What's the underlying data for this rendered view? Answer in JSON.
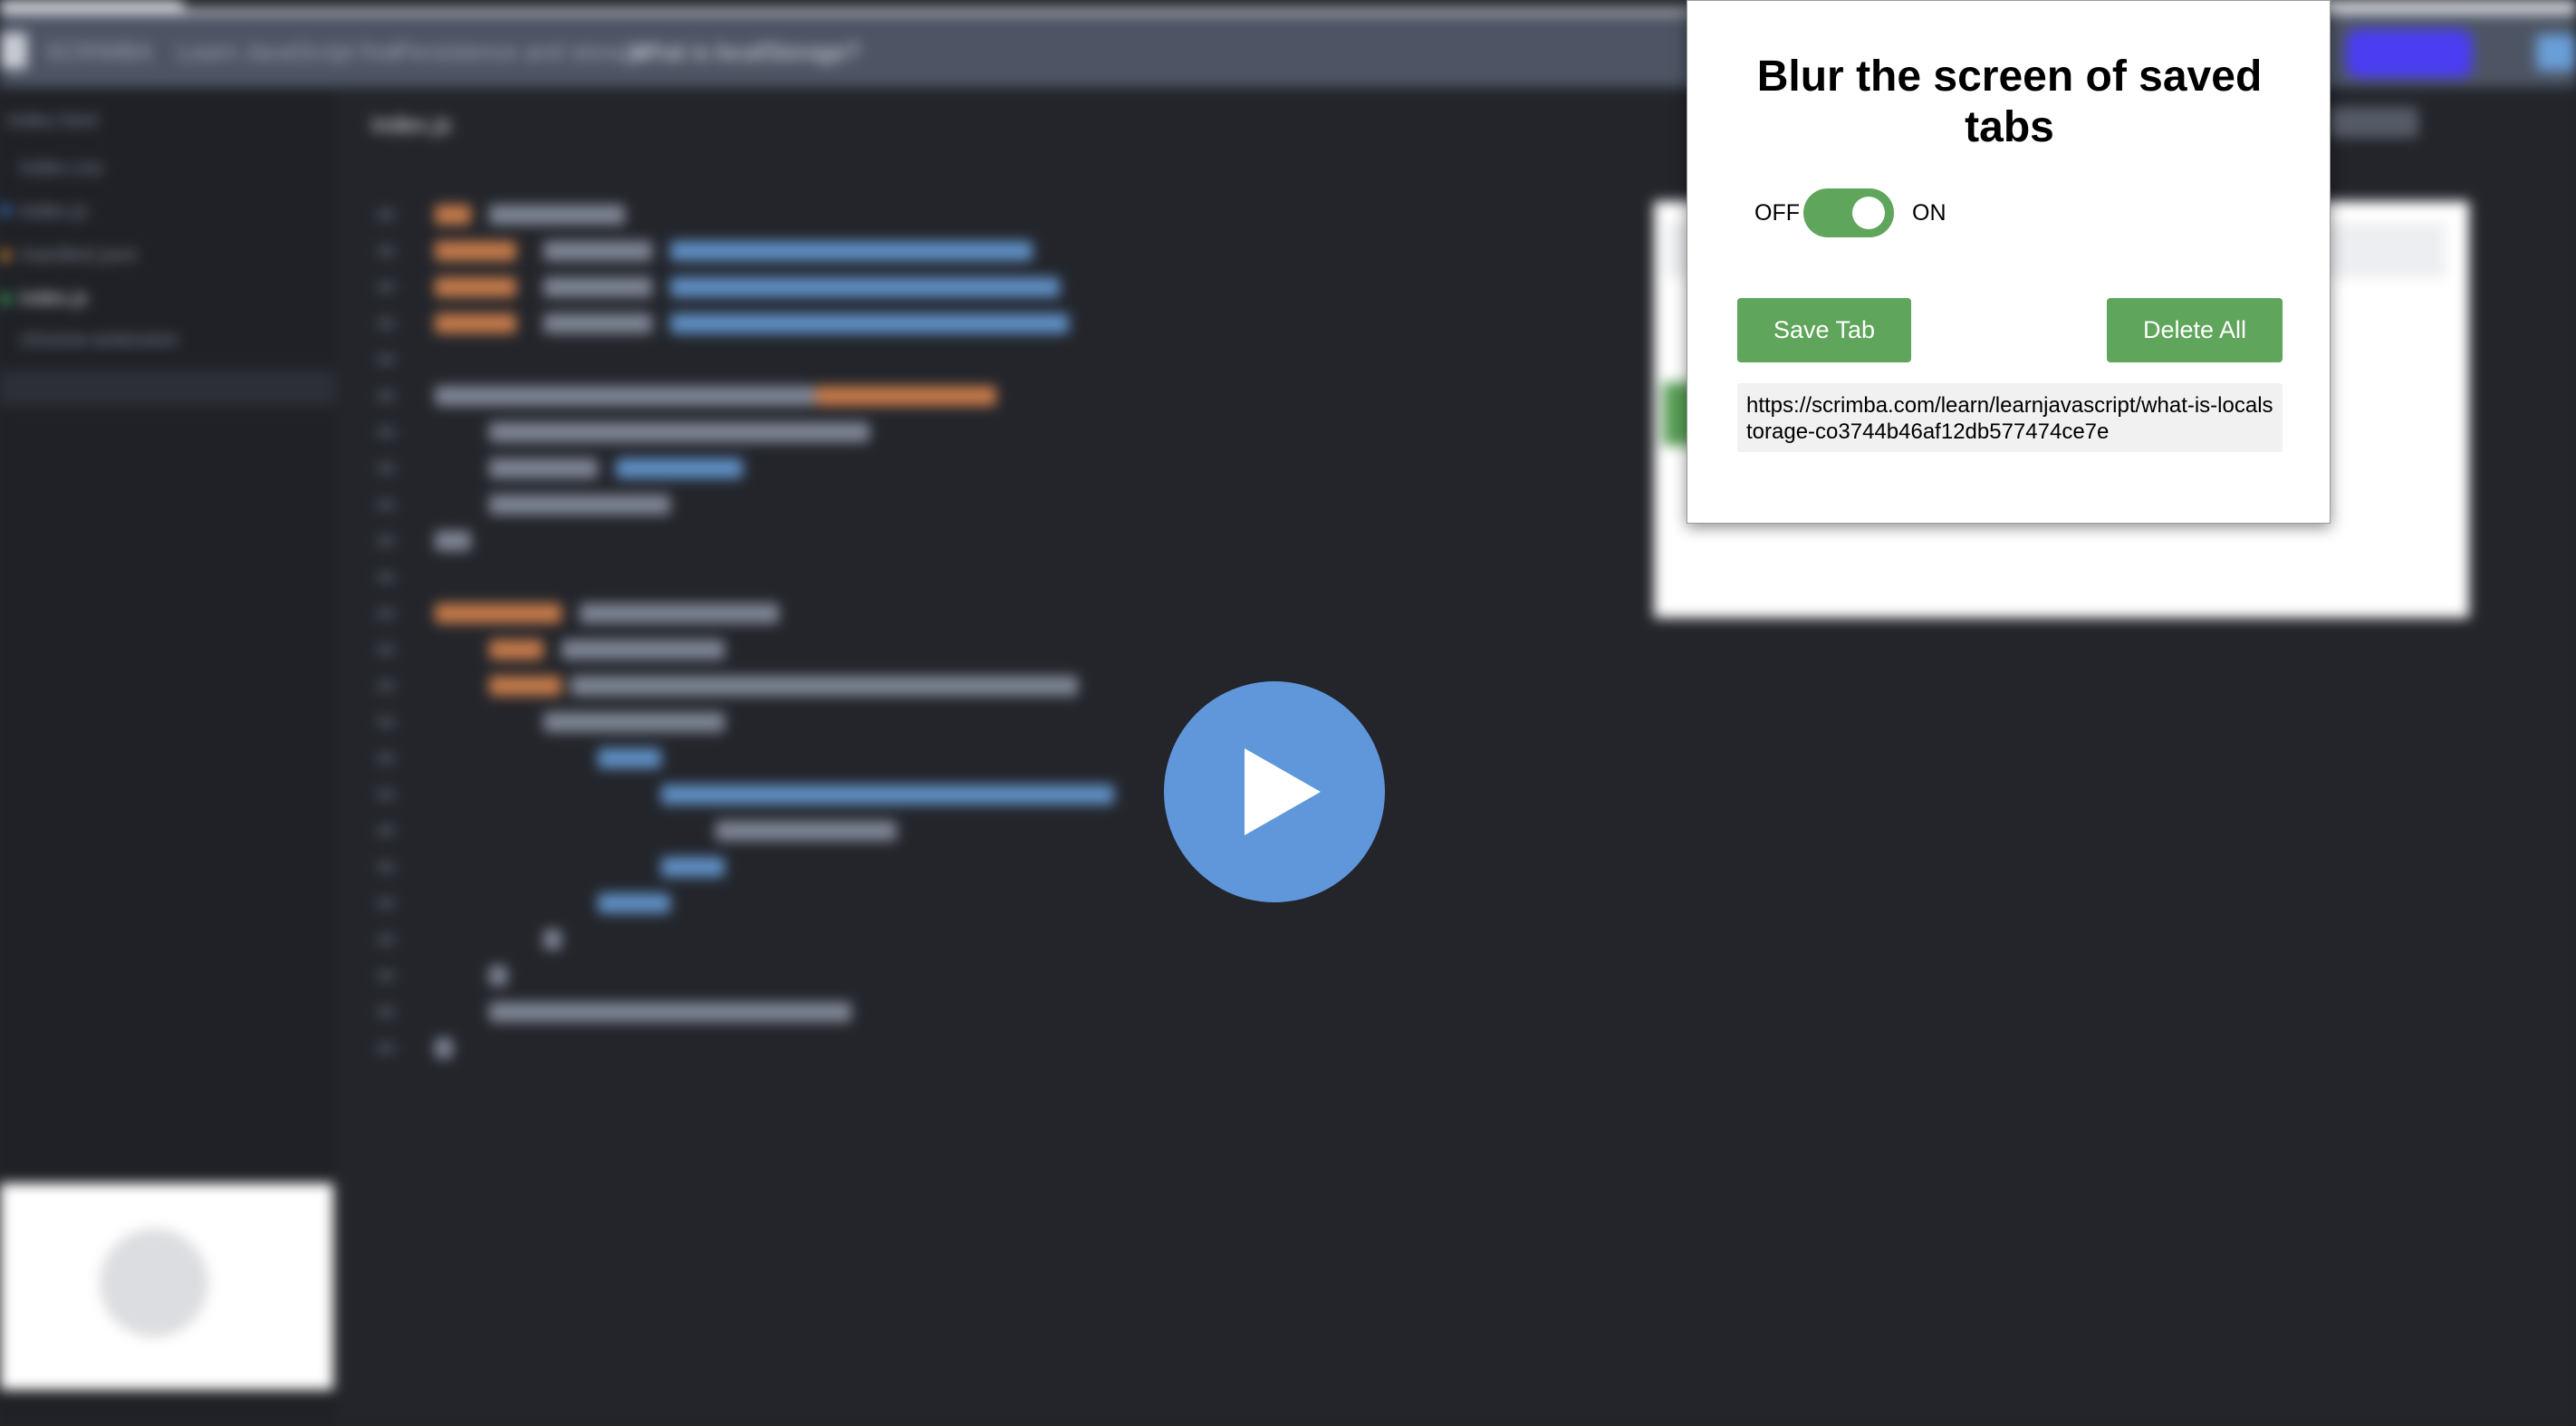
{
  "background": {
    "breadcrumbs": [
      "SCRIMBA",
      "Learn JavaScript free",
      "Persistence and storage",
      "What is localStorage?"
    ],
    "file_tab": "index.js",
    "sidebar_items": [
      "index.html",
      "index.css",
      "index.js",
      "index.js",
      "chrome-extension",
      "manifest.json"
    ]
  },
  "popup": {
    "title": "Blur the screen of saved tabs",
    "toggle": {
      "off_label": "OFF",
      "on_label": "ON",
      "state": "on"
    },
    "save_button": "Save Tab",
    "delete_button": "Delete All",
    "saved_tabs": [
      "https://scrimba.com/learn/learnjavascript/what-is-localstorage-co3744b46af12db577474ce7e"
    ]
  },
  "colors": {
    "accent_green": "#5fa55b",
    "play_blue": "#6097da",
    "editor_bg": "#23252b"
  },
  "icons": {
    "play": "play-icon"
  }
}
